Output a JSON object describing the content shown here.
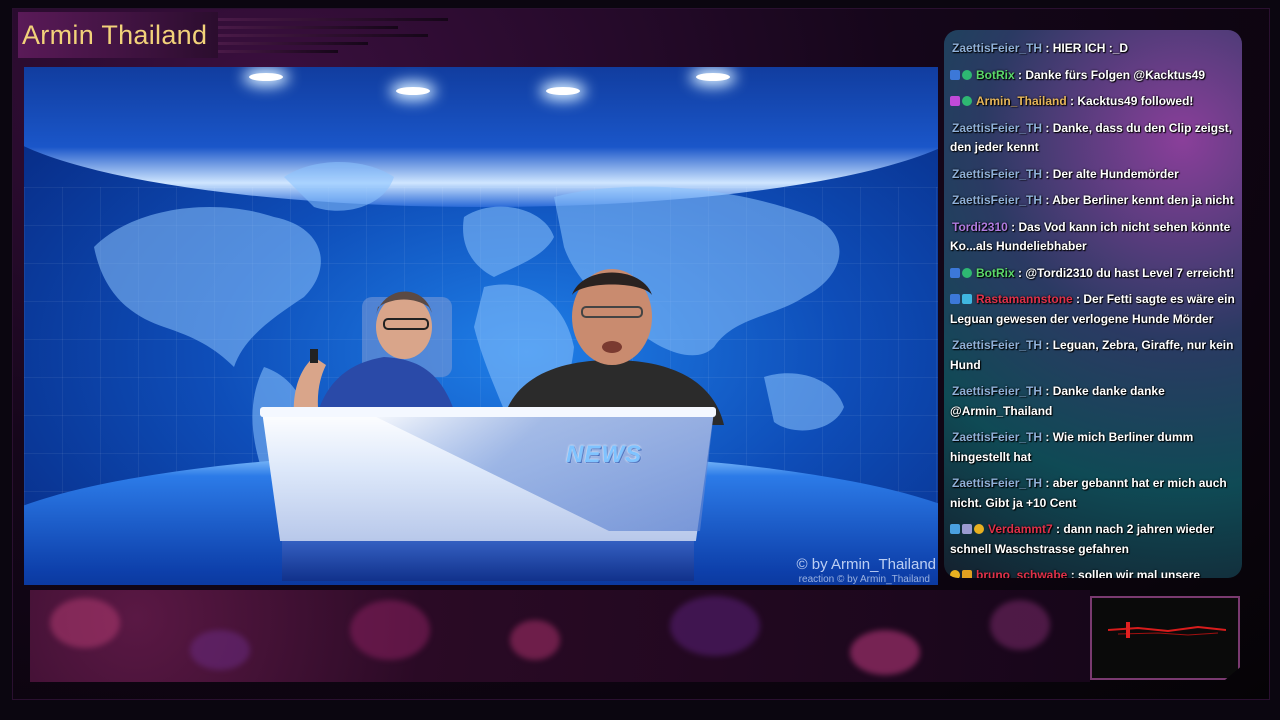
{
  "stream": {
    "title": "Armin Thailand"
  },
  "video": {
    "desk_logo": "NEWS",
    "watermark": "© by Armin_Thailand",
    "watermark_small": "reaction  © by Armin_Thailand"
  },
  "chat": {
    "messages": [
      {
        "user": "ZaettisFeier_TH",
        "user_color": "#8fb0d8",
        "badges": [],
        "text": ": HIER ICH :_D"
      },
      {
        "user": "BotRix",
        "user_color": "#5bd96a",
        "badges": [
          "bot-icon",
          "verified-icon"
        ],
        "text": ": Danke fürs Folgen @Kacktus49"
      },
      {
        "user": "Armin_Thailand",
        "user_color": "#e6b65a",
        "badges": [
          "broadcaster-icon",
          "verified-icon"
        ],
        "text": ": Kacktus49 followed!"
      },
      {
        "user": "ZaettisFeier_TH",
        "user_color": "#8fb0d8",
        "badges": [],
        "text": ": Danke, dass du den Clip zeigst, den jeder kennt"
      },
      {
        "user": "ZaettisFeier_TH",
        "user_color": "#8fb0d8",
        "badges": [],
        "text": ": Der alte Hundemörder"
      },
      {
        "user": "ZaettisFeier_TH",
        "user_color": "#8fb0d8",
        "badges": [],
        "text": ": Aber Berliner kennt den ja nicht"
      },
      {
        "user": "Tordi2310",
        "user_color": "#b07be0",
        "badges": [],
        "text": ": Das Vod kann ich nicht sehen könnte Ko...als Hundeliebhaber"
      },
      {
        "user": "BotRix",
        "user_color": "#5bd96a",
        "badges": [
          "bot-icon",
          "verified-icon"
        ],
        "text": ": @Tordi2310 du hast Level 7 erreicht!"
      },
      {
        "user": "Rastamannstone",
        "user_color": "#e0314a",
        "badges": [
          "bot-icon",
          "subscriber-icon"
        ],
        "text": ": Der Fetti sagte es wäre ein Leguan gewesen der verlogene Hunde Mörder"
      },
      {
        "user": "ZaettisFeier_TH",
        "user_color": "#8fb0d8",
        "badges": [],
        "text": ": Leguan, Zebra, Giraffe, nur kein Hund"
      },
      {
        "user": "ZaettisFeier_TH",
        "user_color": "#8fb0d8",
        "badges": [],
        "text": ": Danke danke danke @Armin_Thailand"
      },
      {
        "user": "ZaettisFeier_TH",
        "user_color": "#8fb0d8",
        "badges": [],
        "text": ": Wie mich Berliner dumm hingestellt hat"
      },
      {
        "user": "ZaettisFeier_TH",
        "user_color": "#8fb0d8",
        "badges": [],
        "text": ": aber gebannt hat er mich auch nicht. Gibt ja +10 Cent"
      },
      {
        "user": "Verdammt7",
        "user_color": "#e0314a",
        "badges": [
          "gem-icon",
          "flag-icon",
          "coin-icon"
        ],
        "text": ": dann nach 2 jahren wieder schnell Waschstrasse gefahren"
      },
      {
        "user": "bruno_schwabe",
        "user_color": "#e0314a",
        "badges": [
          "coin-icon",
          "crown-icon"
        ],
        "text": ": sollen wir mal unsere Beziehungen in TH spielen lassen - sind aber keine Rocker oder Rotlichtgänger Lausie"
      }
    ]
  },
  "colors": {
    "title": "#f2d27a",
    "studio_blue": "#1f7fe8",
    "frame_accent": "#5a1a58"
  }
}
